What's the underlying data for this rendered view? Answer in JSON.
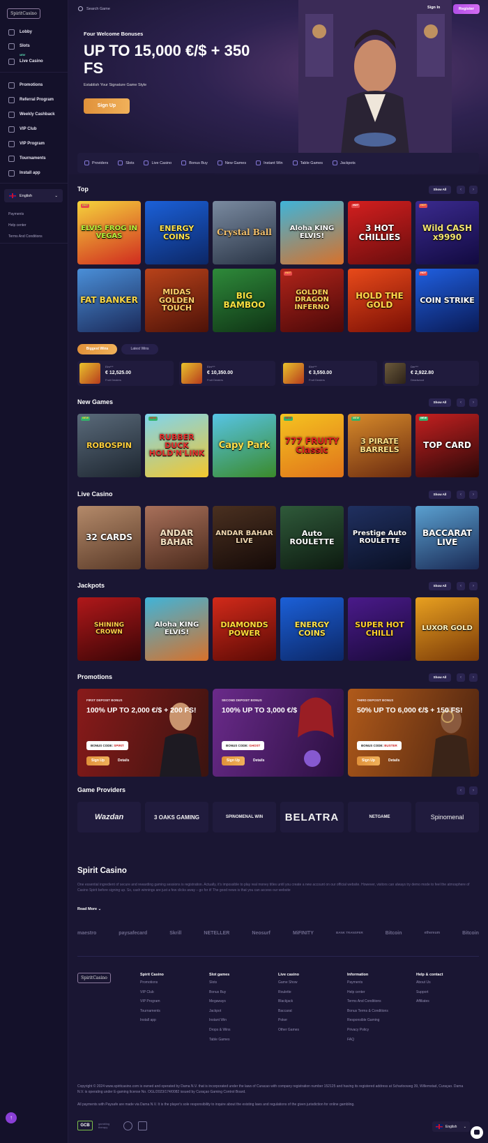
{
  "brand": {
    "logo_text": "SpiritCasino"
  },
  "header": {
    "search_placeholder": "Search Game",
    "signin_label": "Sign In",
    "register_label": "Register"
  },
  "sidebar": {
    "items": [
      {
        "label": "Lobby",
        "icon": "lobby-icon"
      },
      {
        "label": "Slots",
        "icon": "slots-icon"
      },
      {
        "label": "Live Casino",
        "icon": "live-casino-icon",
        "badge": "NEW"
      },
      {
        "label": "Promotions",
        "icon": "gift-icon"
      },
      {
        "label": "Referral Program",
        "icon": "referral-icon"
      },
      {
        "label": "Weekly Cashback",
        "icon": "star-icon"
      },
      {
        "label": "VIP Club",
        "icon": "vip-icon"
      },
      {
        "label": "VIP Program",
        "icon": "crown-icon"
      },
      {
        "label": "Tournaments",
        "icon": "trophy-icon"
      },
      {
        "label": "Install app",
        "icon": "download-icon"
      }
    ],
    "language": "English",
    "links": [
      "Payments",
      "Help center",
      "Terms And Conditions"
    ]
  },
  "hero": {
    "subtitle": "Four Welcome Bonuses",
    "title": "UP TO 15,000 €/$ + 350 FS",
    "tagline": "Establish Your Signature Game Style",
    "cta": "Sign Up"
  },
  "categories": [
    "Providers",
    "Slots",
    "Live Casino",
    "Bonus Buy",
    "New Games",
    "Instant Win",
    "Table Games",
    "Jackpots"
  ],
  "sections": {
    "top": "Top",
    "new_games": "New Games",
    "live_casino": "Live Casino",
    "jackpots": "Jackpots",
    "promotions": "Promotions",
    "providers": "Game Providers",
    "show_all": "Show All"
  },
  "top_games": [
    {
      "name": "ELVIS FROG IN VEGAS",
      "badge": "HOT"
    },
    {
      "name": "ENERGY COINS",
      "badge": ""
    },
    {
      "name": "Crystal Ball",
      "badge": ""
    },
    {
      "name": "Aloha KING ELVIS!",
      "badge": ""
    },
    {
      "name": "3 HOT CHILLIES",
      "badge": "HOT"
    },
    {
      "name": "Wild CASH x9990",
      "badge": "HOT"
    },
    {
      "name": "FAT BANKER",
      "badge": ""
    },
    {
      "name": "MIDAS GOLDEN TOUCH",
      "badge": ""
    },
    {
      "name": "BIG BAMBOO",
      "badge": ""
    },
    {
      "name": "GOLDEN DRAGON INFERNO",
      "badge": "HOT"
    },
    {
      "name": "HOLD THE GOLD",
      "badge": ""
    },
    {
      "name": "COIN STRIKE",
      "badge": "HOT"
    }
  ],
  "wins": {
    "tab_biggest": "Biggest Wins",
    "tab_latest": "Latest Wins",
    "items": [
      {
        "user": "Elm***",
        "amount": "€ 12,525.00",
        "game": "Fruit Dealers"
      },
      {
        "user": "Elm***",
        "amount": "€ 10,350.00",
        "game": "Fruit Dealers"
      },
      {
        "user": "Elm***",
        "amount": "€ 3,550.00",
        "game": "Fruit Dealers"
      },
      {
        "user": "Der***",
        "amount": "€ 2,922.80",
        "game": "Deadwood"
      }
    ]
  },
  "new_games": [
    "ROBOSPIN",
    "RUBBER DUCK HOLD'N'LINK",
    "Capy Park",
    "777 FRUITY Classic",
    "3 PIRATE BARRELS",
    "TOP CARD"
  ],
  "live_games": [
    "32 CARDS",
    "ANDAR BAHAR",
    "ANDAR BAHAR LIVE",
    "Auto ROULETTE",
    "Prestige Auto ROULETTE",
    "BACCARAT LIVE"
  ],
  "jackpot_games": [
    "SHINING CROWN",
    "Aloha KING ELVIS!",
    "DIAMONDS POWER",
    "ENERGY COINS",
    "SUPER HOT CHILLI",
    "LUXOR GOLD"
  ],
  "promos": [
    {
      "label": "FIRST DEPOSIT BONUS",
      "title": "100% UP TO 2,000 €/$ + 200 FS!",
      "code_label": "BONUS CODE:",
      "code": "SPIRIT",
      "cta": "Sign Up",
      "details": "Details"
    },
    {
      "label": "SECOND DEPOSIT BONUS",
      "title": "100% UP TO 3,000 €/$",
      "code_label": "BONUS CODE:",
      "code": "GHOST",
      "cta": "Sign Up",
      "details": "Details"
    },
    {
      "label": "THIRD DEPOSIT BONUS",
      "title": "50% UP TO 6,000 €/$ + 150 FS!",
      "code_label": "BONUS CODE:",
      "code": "BUSTER",
      "cta": "Sign Up",
      "details": "Details"
    }
  ],
  "providers": [
    "Wazdan",
    "3 OAKS GAMING",
    "SPINOMENAL WIN",
    "BELATRA",
    "NETGAME",
    "Spinomenal"
  ],
  "about": {
    "title": "Spirit Casino",
    "text": "One essential ingredient of secure and rewarding gaming sessions is registration. Actually, it's impossible to play real money titles until you create a new account on our official website. However, visitors can always try demo mode to feel the atmosphere of Casino Spirit before signing up. So, cash winnings are just a few clicks away – go for it! The good news is that you can access our website",
    "read_more": "Read More"
  },
  "payments": [
    "maestro",
    "paysafecard",
    "Skrill",
    "NETELLER",
    "Neosurf",
    "MiFINITY",
    "BANK TRANSFER",
    "Bitcoin",
    "ethereum",
    "Bitcoin"
  ],
  "footer": {
    "columns": [
      {
        "title": "Spirit Casino",
        "links": [
          "Promotions",
          "VIP Club",
          "VIP Program",
          "Tournaments",
          "Install app"
        ]
      },
      {
        "title": "Slot games",
        "links": [
          "Slots",
          "Bonus Buy",
          "Megaways",
          "Jackpot",
          "Instant Win",
          "Drops & Wins",
          "Table Games"
        ]
      },
      {
        "title": "Live casino",
        "links": [
          "Game Show",
          "Roulette",
          "Blackjack",
          "Baccarat",
          "Poker",
          "Other Games"
        ]
      },
      {
        "title": "Information",
        "links": [
          "Payments",
          "Help center",
          "Terms And Conditions",
          "Bonus Terms & Conditions",
          "Responsible Gaming",
          "Privacy Policy",
          "FAQ"
        ]
      },
      {
        "title": "Help & contact",
        "links": [
          "About Us",
          "Support",
          "Affiliates"
        ]
      }
    ],
    "copyright": "Copyright © 2024 www.spiritcasino.com is owned and operated by Dama N.V. that is incorporated under the laws of Curacao with company registration number 152125 and having its registered address at Scharlooweg 39, Willemstad, Curaçao. Dama N.V. is operating under E-gaming license No. OGL/2023/174/0082 issued by Curaçao Gaming Control Board.",
    "payments_note": "All payments with Paysafe are made via Dama N.V. It is the player's sole responsibility to inquire about the existing laws and regulations of the given jurisdiction for online gambling.",
    "gcb": "GCB",
    "gamblingtherapy": "gambling therapy",
    "language": "English"
  }
}
